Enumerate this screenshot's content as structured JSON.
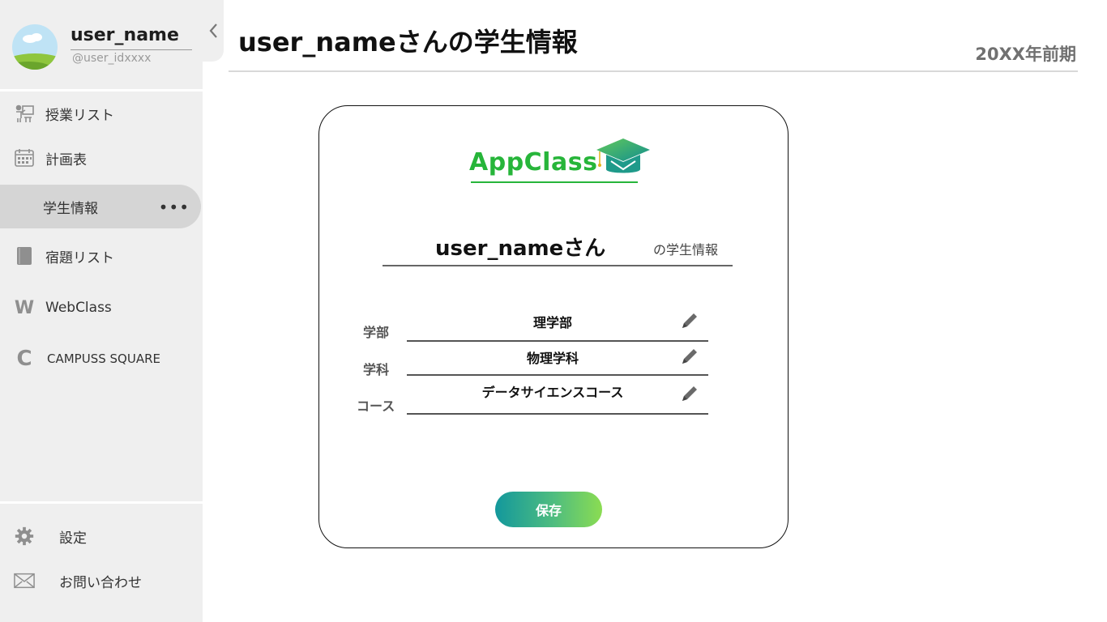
{
  "user": {
    "name": "user_name",
    "id": "@user_idxxxx"
  },
  "nav": {
    "items": [
      {
        "label": "授業リスト",
        "icon": "presentation-icon"
      },
      {
        "label": "計画表",
        "icon": "calendar-icon"
      },
      {
        "label": "学生情報",
        "icon": "none",
        "active": true
      },
      {
        "label": "宿題リスト",
        "icon": "book-icon"
      },
      {
        "label": "WebClass",
        "icon": "W"
      },
      {
        "label": "CAMPUSS SQUARE",
        "icon": "C"
      }
    ],
    "more_label": "•••",
    "bottom": [
      {
        "label": "設定",
        "icon": "gear-icon"
      },
      {
        "label": "お問い合わせ",
        "icon": "mail-icon"
      }
    ]
  },
  "header": {
    "title": "user_nameさんの学生情報",
    "term": "20XX年前期"
  },
  "card": {
    "logo_text": "AppClass",
    "user_display": "user_nameさん",
    "suffix": "の学生情報",
    "fields": [
      {
        "label": "学部",
        "value": "理学部"
      },
      {
        "label": "学科",
        "value": "物理学科"
      },
      {
        "label": "コース",
        "value": "データサイエンスコース"
      }
    ],
    "save_label": "保存"
  },
  "colors": {
    "sidebar_bg": "#efefef",
    "active_bg": "#d5d5d5",
    "brand_green": "#27b53a",
    "button_gradient_start": "#13989c",
    "button_gradient_end": "#8bdc52"
  }
}
